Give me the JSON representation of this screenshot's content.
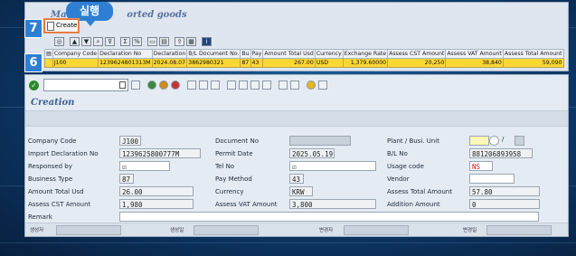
{
  "top": {
    "title_left": "Manag",
    "title_right": "orted goods",
    "run_badge": "실행",
    "step7": "7",
    "step6": "6",
    "create_label": "Create",
    "grid_headers": [
      "Company Code",
      "Declaration No",
      "Declaration",
      "B/L Document No.",
      "Bu",
      "Pay",
      "Amount Total Usd",
      "Currency",
      "Exchange Rate",
      "Assess CST Amount",
      "Assess VAT Amount",
      "Assess Total Amount"
    ],
    "grid_row": [
      "J100",
      "12396248013​13M",
      "2024.08.07",
      "3862980321",
      "87",
      "43",
      "267.00",
      "USD",
      "1,379.60000",
      "20,250",
      "38,840",
      "59,090"
    ]
  },
  "bottom": {
    "section_title": "Creation",
    "fields": {
      "company_code_label": "Company Code",
      "company_code": "J100",
      "import_decl_label": "Import Declaration No",
      "import_decl": "12396258007​77M",
      "responsed_by_label": "Responsed by",
      "responsed_by": "☑",
      "business_type_label": "Business Type",
      "business_type": "87",
      "amount_total_label": "Amount Total Usd",
      "amount_total": "26.00",
      "assess_cst_label": "Assess CST Amount",
      "assess_cst": "1,980",
      "remark_label": "Remark",
      "document_no_label": "Document No",
      "document_no": "",
      "permit_date_label": "Permit Date",
      "permit_date": "2025.05.19",
      "tel_no_label": "Tel No",
      "tel_no": "☑",
      "pay_method_label": "Pay Method",
      "pay_method": "43",
      "currency_label": "Currency",
      "currency": "KRW",
      "assess_vat_label": "Assess VAT Amount",
      "assess_vat": "3,800",
      "plant_label": "Plant / Busi. Unit",
      "plant_sep": "/",
      "bl_no_label": "B/L No",
      "bl_no": "881206893958",
      "usage_code_label": "Usage code",
      "usage_code": "NS",
      "vendor_label": "Vendor",
      "vendor": "",
      "assess_total_label": "Assess Total Amount",
      "assess_total": "57.80",
      "addition_label": "Addition Amount",
      "addition": "0"
    },
    "footer": {
      "created_by": "생성자",
      "created_on": "생성일",
      "changed_by": "변경자",
      "changed_on": "변경일"
    }
  },
  "colors": {
    "accent": "#2e7fd4",
    "row_highlight": "#ffd733",
    "highlight_border": "#e2702b"
  }
}
